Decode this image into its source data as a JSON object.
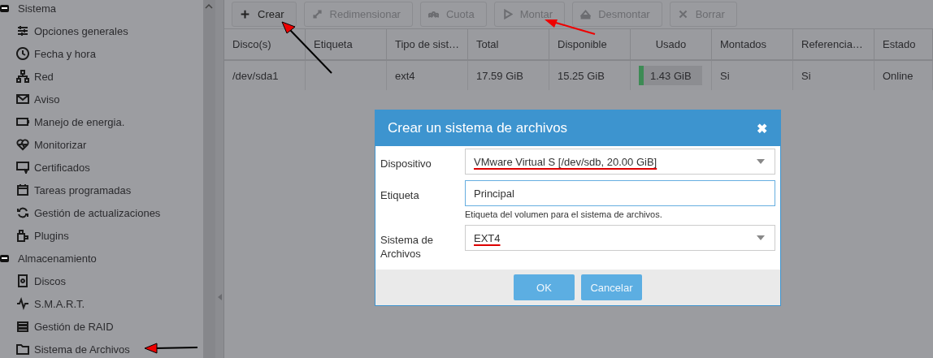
{
  "sidebar": {
    "groups": [
      {
        "label": "Sistema",
        "expanded": true,
        "items": [
          {
            "label": "Opciones generales"
          },
          {
            "label": "Fecha y hora"
          },
          {
            "label": "Red"
          },
          {
            "label": "Aviso"
          },
          {
            "label": "Manejo de energia."
          },
          {
            "label": "Monitorizar"
          },
          {
            "label": "Certificados"
          },
          {
            "label": "Tareas programadas"
          },
          {
            "label": "Gestión de actualizaciones"
          },
          {
            "label": "Plugins"
          }
        ]
      },
      {
        "label": "Almacenamiento",
        "expanded": true,
        "items": [
          {
            "label": "Discos"
          },
          {
            "label": "S.M.A.R.T."
          },
          {
            "label": "Gestión de RAID"
          },
          {
            "label": "Sistema de Archivos"
          }
        ]
      }
    ]
  },
  "toolbar": [
    {
      "label": "Crear",
      "disabled": false
    },
    {
      "label": "Redimensionar",
      "disabled": true
    },
    {
      "label": "Cuota",
      "disabled": true
    },
    {
      "label": "Montar",
      "disabled": true
    },
    {
      "label": "Desmontar",
      "disabled": true
    },
    {
      "label": "Borrar",
      "disabled": true
    }
  ],
  "table": {
    "columns": [
      "Disco(s)",
      "Etiqueta",
      "Tipo de sist…",
      "Total",
      "Disponible",
      "Usado",
      "Montados",
      "Referencia…",
      "Estado"
    ],
    "rows": [
      {
        "disk": "/dev/sda1",
        "type": "ext4",
        "total": "17.59 GiB",
        "available": "15.25 GiB",
        "used": {
          "reading": "1.43 GiB",
          "level": 0.08
        },
        "mounted": "Si",
        "referenced": "Si",
        "status": "Online"
      }
    ]
  },
  "dialog": {
    "title": "Crear un sistema de archivos",
    "close": "✖",
    "fields": [
      {
        "kind": "select",
        "label": "Dispositivo",
        "value": "VMware Virtual S [/dev/sdb, 20.00 GiB]",
        "underlined": true
      },
      {
        "kind": "text",
        "label": "Etiqueta",
        "value": "Principal",
        "hint": "Etiqueta del volumen para el sistema de archivos."
      },
      {
        "kind": "select",
        "label": "Sistema de Archivos",
        "value": "EXT4",
        "underlined": true
      }
    ],
    "buttons": [
      "OK",
      "Cancelar"
    ]
  }
}
